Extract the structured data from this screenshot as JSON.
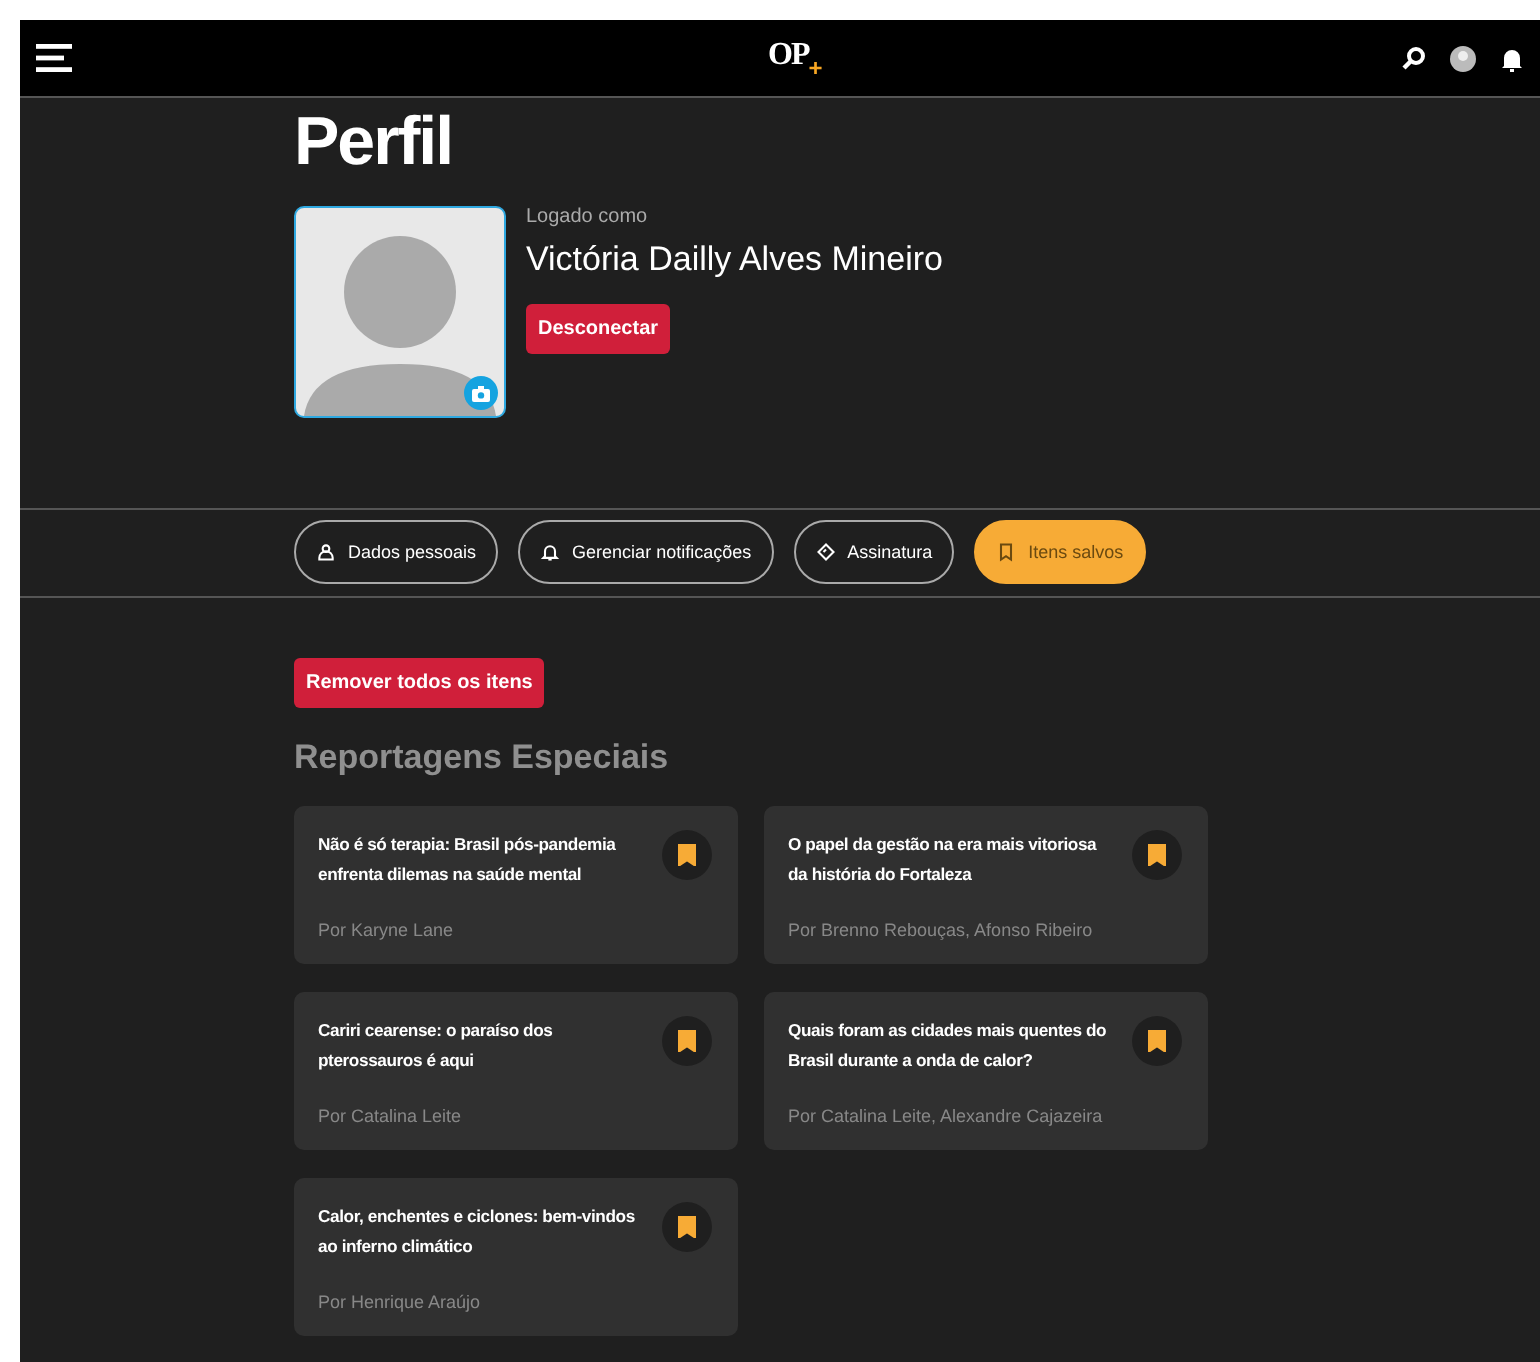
{
  "header": {
    "logo": {
      "text": "OP",
      "mark": "+"
    }
  },
  "page_title": "Perfil",
  "profile": {
    "caption": "Logado como",
    "name": "Victória Dailly Alves Mineiro",
    "logout_button": "Desconectar"
  },
  "tabs": [
    {
      "label": "Dados pessoais",
      "kind": "person",
      "selected": false
    },
    {
      "label": "Gerenciar notificações",
      "kind": "bell",
      "selected": false
    },
    {
      "label": "Assinatura",
      "kind": "tag",
      "selected": false
    },
    {
      "label": "Itens salvos",
      "kind": "bookmark",
      "selected": true
    }
  ],
  "remove_all_button": "Remover todos os itens",
  "section_title": "Reportagens Especiais",
  "articles": [
    {
      "title": "Não é só terapia: Brasil pós-pandemia enfrenta dilemas na saúde mental",
      "byline": "Por Karyne Lane",
      "saved": true
    },
    {
      "title": "O papel da gestão na era mais vitoriosa da história do Fortaleza",
      "byline": "Por Brenno Rebouças, Afonso Ribeiro",
      "saved": true
    },
    {
      "title": "Cariri cearense: o paraíso dos pterossauros é aqui",
      "byline": "Por Catalina Leite",
      "saved": true
    },
    {
      "title": "Quais foram as cidades mais quentes do Brasil durante a onda de calor?",
      "byline": "Por Catalina Leite, Alexandre Cajazeira",
      "saved": true
    },
    {
      "title": "Calor, enchentes e ciclones: bem-vindos ao inferno climático",
      "byline": "Por Henrique Araújo",
      "saved": true
    }
  ]
}
